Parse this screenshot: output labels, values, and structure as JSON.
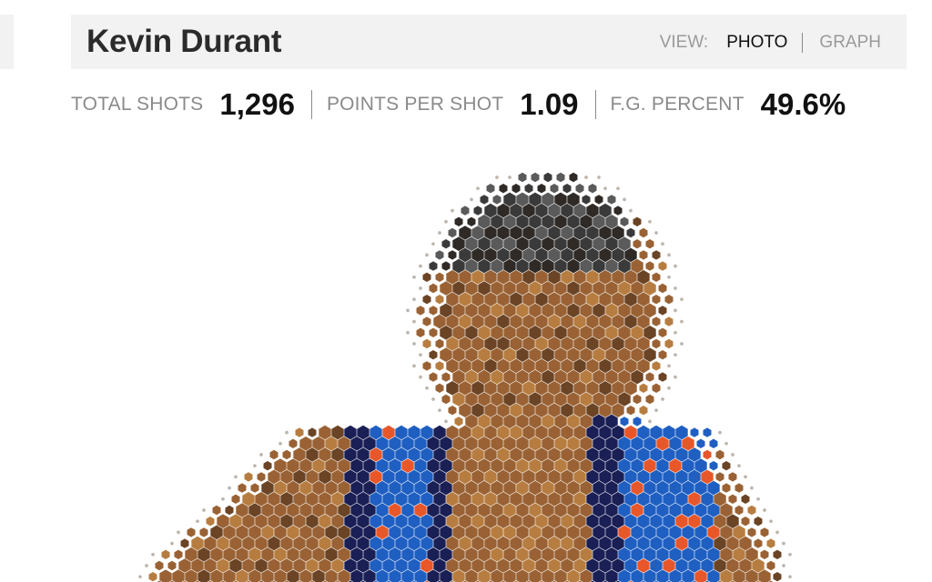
{
  "header": {
    "player_name": "Kevin Durant",
    "view_label": "VIEW:",
    "view_options": [
      {
        "label": "PHOTO",
        "active": true
      },
      {
        "label": "GRAPH",
        "active": false
      }
    ]
  },
  "stats": [
    {
      "label": "TOTAL SHOTS",
      "value": "1,296"
    },
    {
      "label": "POINTS PER SHOT",
      "value": "1.09"
    },
    {
      "label": "F.G. PERCENT",
      "value": "49.6%"
    }
  ],
  "photo": {
    "palette": {
      "hair": "#3a3a3a",
      "skin_dark": "#6b4425",
      "skin": "#9a6234",
      "skin_light": "#b77d40",
      "jersey_blue": "#1f5fc2",
      "jersey_navy": "#1a1f55",
      "jersey_orange": "#e8572a"
    }
  }
}
